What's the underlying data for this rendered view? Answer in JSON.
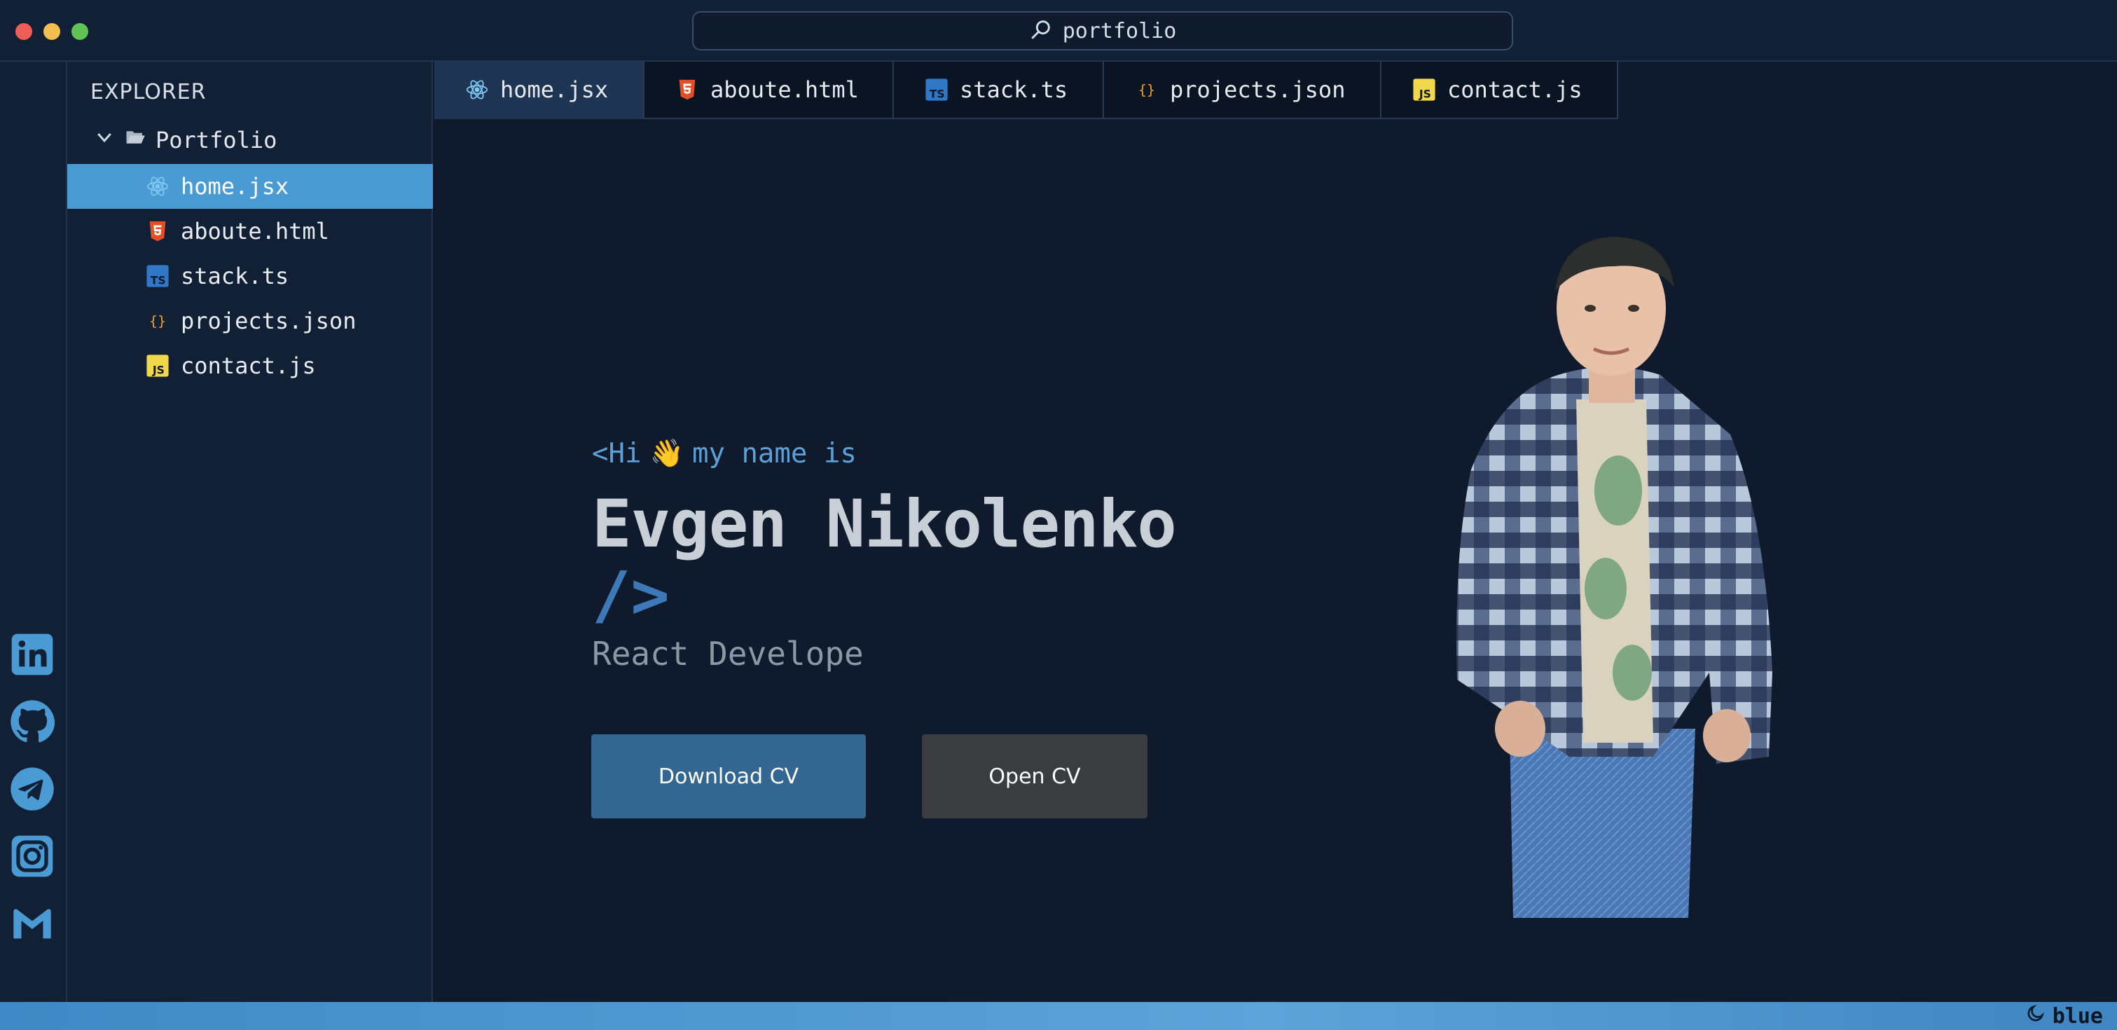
{
  "window": {
    "search_text": "portfolio"
  },
  "explorer": {
    "title": "EXPLORER",
    "folder": "Portfolio",
    "files": [
      {
        "label": "home.jsx",
        "icon": "react-icon",
        "active": true
      },
      {
        "label": "aboute.html",
        "icon": "html5-icon"
      },
      {
        "label": "stack.ts",
        "icon": "typescript-icon"
      },
      {
        "label": "projects.json",
        "icon": "json-icon"
      },
      {
        "label": "contact.js",
        "icon": "javascript-icon"
      }
    ]
  },
  "tabs": [
    {
      "label": "home.jsx",
      "icon": "react-icon",
      "active": true
    },
    {
      "label": "aboute.html",
      "icon": "html5-icon"
    },
    {
      "label": "stack.ts",
      "icon": "typescript-icon"
    },
    {
      "label": "projects.json",
      "icon": "json-icon"
    },
    {
      "label": "contact.js",
      "icon": "javascript-icon"
    }
  ],
  "social_icons": [
    "linkedin-icon",
    "github-icon",
    "telegram-icon",
    "instagram-icon",
    "gmail-icon"
  ],
  "hero": {
    "greeting_prefix": "<Hi",
    "wave": "👋",
    "greeting_suffix": "my name is",
    "name": "Evgen Nikolenko",
    "closing_tag": "/>",
    "role": "React Develope",
    "primary_button": "Download CV",
    "secondary_button": "Open CV"
  },
  "statusbar": {
    "theme": "blue"
  },
  "colors": {
    "background": "#0f1b2d",
    "panel": "#122035",
    "accent": "#4a9ad4",
    "primary_button": "#336690",
    "secondary_button": "#3b3c40",
    "greeting": "#5d9fd6"
  }
}
